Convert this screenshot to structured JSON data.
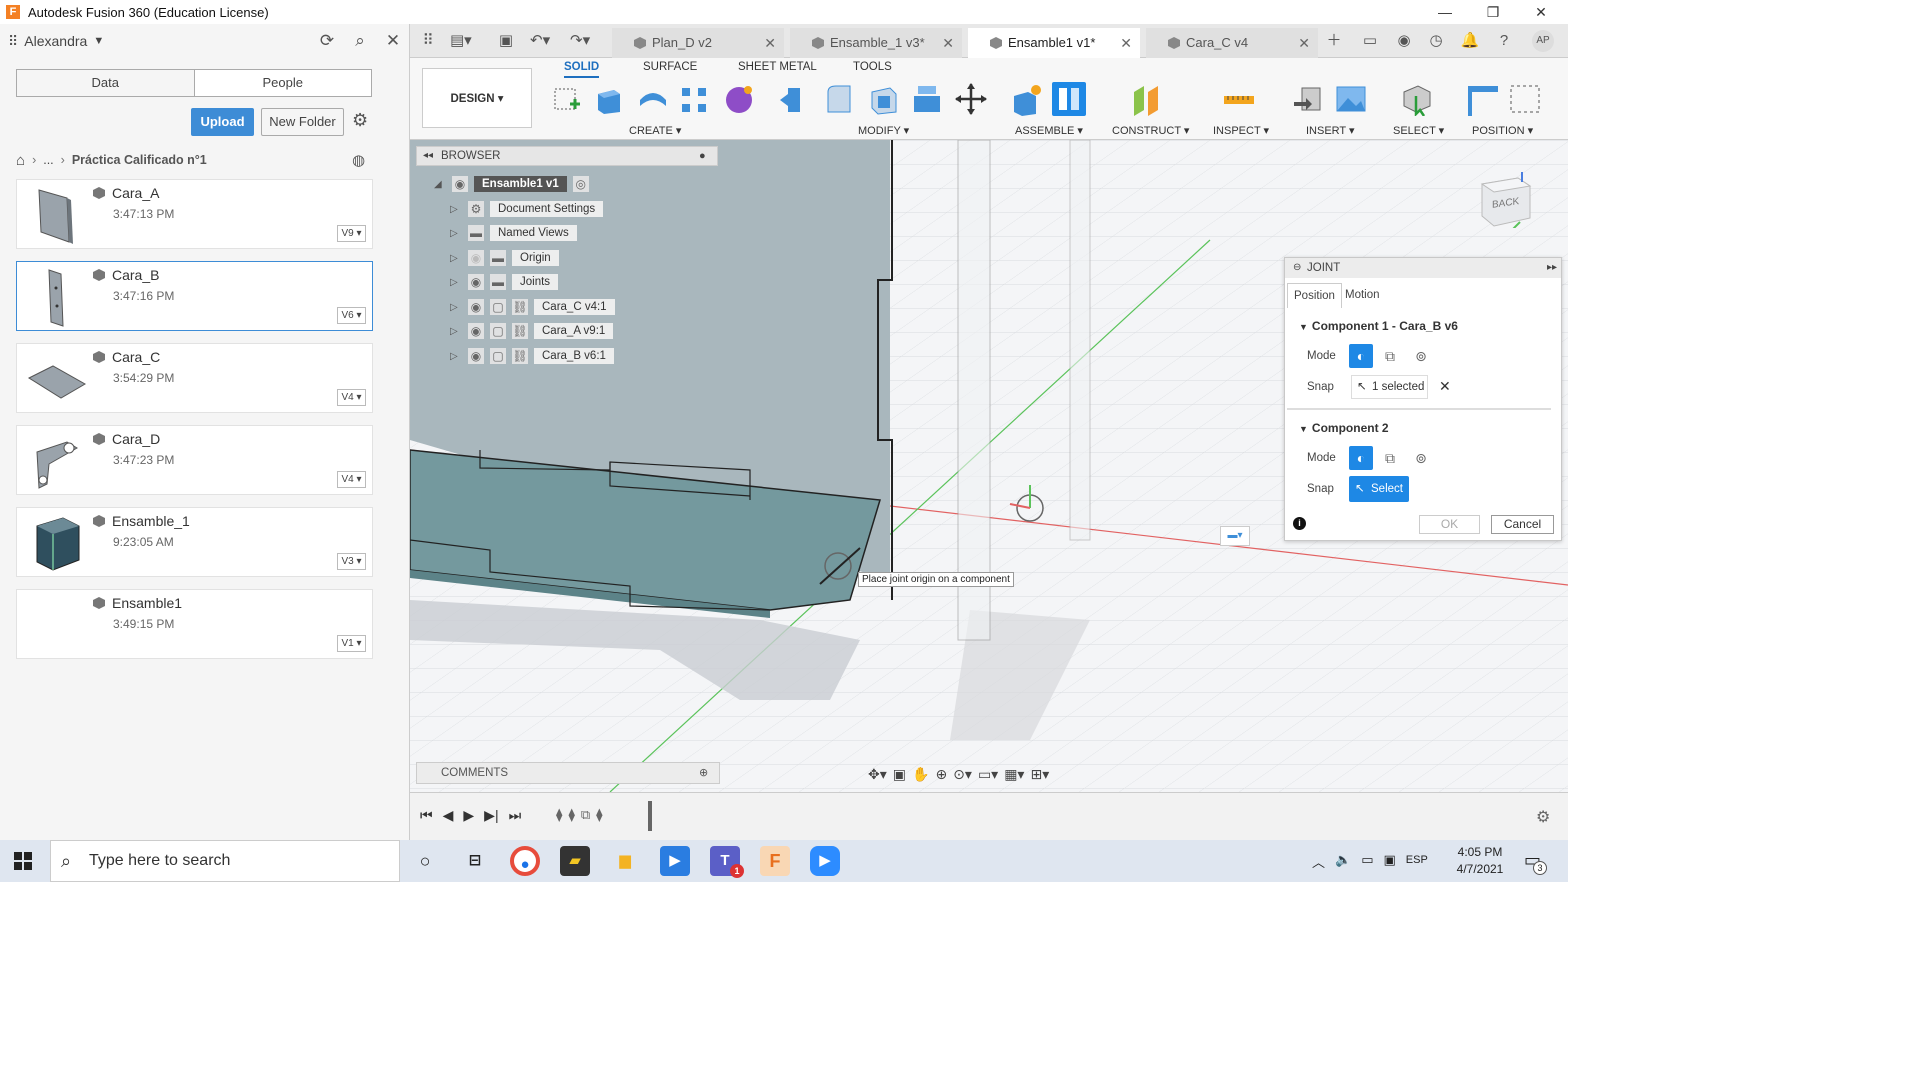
{
  "window": {
    "title": "Autodesk Fusion 360 (Education License)",
    "logo": "F"
  },
  "left_panel": {
    "user": "Alexandra",
    "tabs": [
      "Data",
      "People"
    ],
    "upload_label": "Upload",
    "new_folder_label": "New Folder",
    "breadcrumb": {
      "ellipsis": "...",
      "project": "Práctica Calificado n°1"
    },
    "files": [
      {
        "name": "Cara_A",
        "time": "3:47:13 PM",
        "version": "V9"
      },
      {
        "name": "Cara_B",
        "time": "3:47:16 PM",
        "version": "V6"
      },
      {
        "name": "Cara_C",
        "time": "3:54:29 PM",
        "version": "V4"
      },
      {
        "name": "Cara_D",
        "time": "3:47:23 PM",
        "version": "V4"
      },
      {
        "name": "Ensamble_1",
        "time": "9:23:05 AM",
        "version": "V3"
      },
      {
        "name": "Ensamble1",
        "time": "3:49:15 PM",
        "version": "V1"
      }
    ]
  },
  "doc_tabs": [
    {
      "label": "Plan_D v2"
    },
    {
      "label": "Ensamble_1 v3*"
    },
    {
      "label": "Ensamble1 v1*"
    },
    {
      "label": "Cara_C v4"
    }
  ],
  "user_initials": "AP",
  "ribbon": {
    "workspace": "DESIGN ▾",
    "tabs": [
      "SOLID",
      "SURFACE",
      "SHEET METAL",
      "TOOLS"
    ],
    "groups": [
      "CREATE ▾",
      "MODIFY ▾",
      "ASSEMBLE ▾",
      "CONSTRUCT ▾",
      "INSPECT ▾",
      "INSERT ▾",
      "SELECT ▾",
      "POSITION ▾"
    ]
  },
  "browser": {
    "title": "BROWSER",
    "root": "Ensamble1 v1",
    "items": [
      "Document Settings",
      "Named Views",
      "Origin",
      "Joints",
      "Cara_C v4:1",
      "Cara_A v9:1",
      "Cara_B v6:1"
    ]
  },
  "viewcube_label": "BACK",
  "joint": {
    "title": "JOINT",
    "tabs": [
      "Position",
      "Motion"
    ],
    "component1": "Component 1 - Cara_B v6",
    "component2": "Component 2",
    "mode_label": "Mode",
    "snap_label": "Snap",
    "snap1_value": "1 selected",
    "snap2_value": "Select",
    "ok": "OK",
    "cancel": "Cancel"
  },
  "tooltip": "Place joint origin on a component",
  "comments": "COMMENTS",
  "taskbar": {
    "search_placeholder": "Type here to search",
    "lang": "ESP",
    "time": "4:05 PM",
    "date": "4/7/2021",
    "notifications": "3",
    "teams_badge": "1"
  },
  "colors": {
    "accent": "#1e88e5",
    "upload": "#3d8cd6",
    "fusion": "#f48024"
  }
}
